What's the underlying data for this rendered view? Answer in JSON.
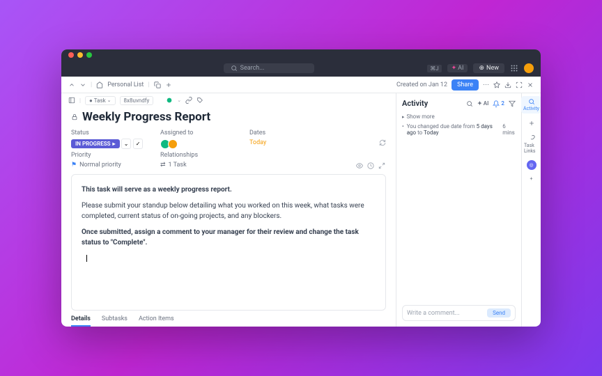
{
  "topbar": {
    "search_placeholder": "Search...",
    "shortcut": "⌘J",
    "ai_label": "AI",
    "new_label": "New"
  },
  "crumb": {
    "location": "Personal List",
    "created": "Created on Jan 12",
    "share": "Share"
  },
  "meta": {
    "type": "Task",
    "id": "8x8uvndfy"
  },
  "title": "Weekly Progress Report",
  "fields": {
    "status_label": "Status",
    "status_value": "IN PROGRESS",
    "assigned_label": "Assigned to",
    "dates_label": "Dates",
    "dates_value": "Today",
    "priority_label": "Priority",
    "priority_value": "Normal priority",
    "relationships_label": "Relationships",
    "relationships_value": "1 Task"
  },
  "description": {
    "p1": "This task will serve as a weekly progress report.",
    "p2": "Please submit your standup below detailing what you worked on this week, what tasks were completed, current status of on-going projects, and any blockers.",
    "p3": "Once submitted, assign a comment to your manager for their review and change the task status to \"Complete\"."
  },
  "tabs": {
    "details": "Details",
    "subtasks": "Subtasks",
    "actions": "Action Items"
  },
  "activity": {
    "heading": "Activity",
    "ai": "AI",
    "notif": "2",
    "show_more": "Show more",
    "item": {
      "text_prefix": "You changed due date from ",
      "from": "5 days ago",
      "mid": " to ",
      "to": "Today",
      "time": "6 mins"
    },
    "comment_placeholder": "Write a comment...",
    "send": "Send"
  },
  "rail": {
    "activity": "Activity",
    "task_links": "Task Links"
  }
}
